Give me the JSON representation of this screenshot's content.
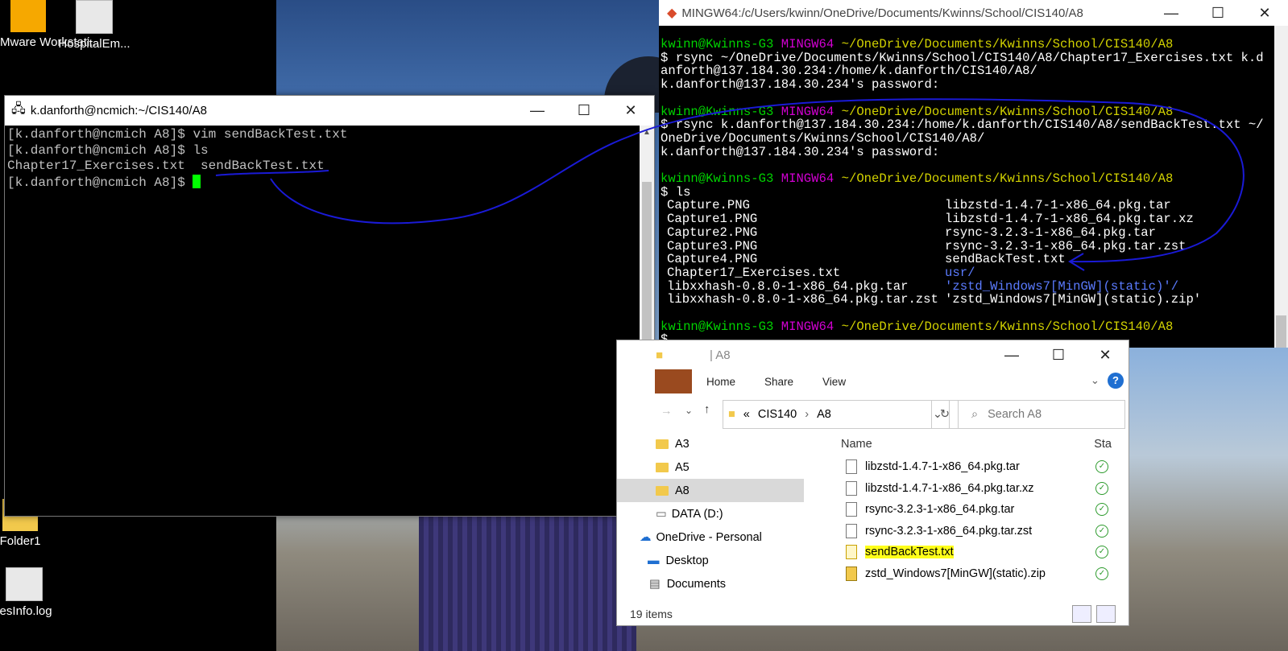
{
  "desktop": {
    "icons": [
      {
        "label": "VMware Workstati...",
        "name": "vmware"
      },
      {
        "label": "HospitalEm...",
        "name": "hospital"
      },
      {
        "label": "Folder1",
        "name": "folder1"
      },
      {
        "label": "tesInfo.log",
        "name": "tesinfo"
      }
    ]
  },
  "putty": {
    "title": "k.danforth@ncmich:~/CIS140/A8",
    "lines": [
      "[k.danforth@ncmich A8]$ vim sendBackTest.txt",
      "[k.danforth@ncmich A8]$ ls",
      "Chapter17_Exercises.txt  sendBackTest.txt",
      "[k.danforth@ncmich A8]$ "
    ]
  },
  "gitbash": {
    "title": "MINGW64:/c/Users/kwinn/OneDrive/Documents/Kwinns/School/CIS140/A8",
    "prompt_user": "kwinn@Kwinns-G3",
    "prompt_env": "MINGW64",
    "prompt_path": "~/OneDrive/Documents/Kwinns/School/CIS140/A8",
    "cmd1": "$ rsync ~/OneDrive/Documents/Kwinns/School/CIS140/A8/Chapter17_Exercises.txt k.d",
    "cmd1b": "anforth@137.184.30.234:/home/k.danforth/CIS140/A8/",
    "pw1": "k.danforth@137.184.30.234's password:",
    "cmd2": "$ rsync k.danforth@137.184.30.234:/home/k.danforth/CIS140/A8/sendBackTest.txt ~/",
    "cmd2b": "OneDrive/Documents/Kwinns/School/CIS140/A8/",
    "pw2": "k.danforth@137.184.30.234's password:",
    "cmd3": "$ ls",
    "ls_left": [
      "Capture.PNG",
      "Capture1.PNG",
      "Capture2.PNG",
      "Capture3.PNG",
      "Capture4.PNG",
      "Chapter17_Exercises.txt",
      "libxxhash-0.8.0-1-x86_64.pkg.tar",
      "libxxhash-0.8.0-1-x86_64.pkg.tar.zst"
    ],
    "ls_right": [
      "libzstd-1.4.7-1-x86_64.pkg.tar",
      "libzstd-1.4.7-1-x86_64.pkg.tar.xz",
      "rsync-3.2.3-1-x86_64.pkg.tar",
      "rsync-3.2.3-1-x86_64.pkg.tar.zst",
      "sendBackTest.txt",
      "usr/",
      "'zstd_Windows7[MinGW](static)'/",
      "'zstd_Windows7[MinGW](static).zip'"
    ],
    "last_prompt": "$ "
  },
  "explorer": {
    "title": "A8",
    "ribbon_tabs": [
      "Home",
      "Share",
      "View"
    ],
    "breadcrumb": [
      "«",
      "CIS140",
      "A8"
    ],
    "search_placeholder": "Search A8",
    "nav_items": [
      "A3",
      "A5",
      "A8",
      "DATA (D:)",
      "OneDrive - Personal",
      "Desktop",
      "Documents"
    ],
    "col_name": "Name",
    "col_status": "Sta",
    "files": [
      "libzstd-1.4.7-1-x86_64.pkg.tar",
      "libzstd-1.4.7-1-x86_64.pkg.tar.xz",
      "rsync-3.2.3-1-x86_64.pkg.tar",
      "rsync-3.2.3-1-x86_64.pkg.tar.zst",
      "sendBackTest.txt",
      "zstd_Windows7[MinGW](static).zip"
    ],
    "status": "19 items"
  },
  "colors": {
    "annotation_pen": "#1a1ad6",
    "highlight": "#ffff1a"
  }
}
